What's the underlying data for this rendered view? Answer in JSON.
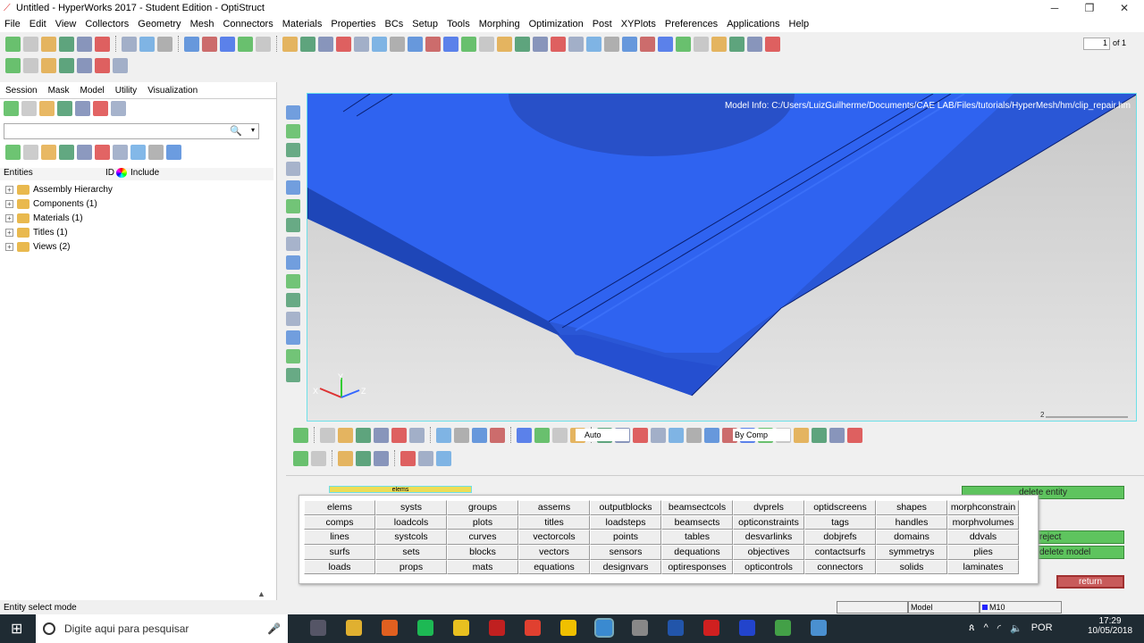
{
  "window": {
    "title": "Untitled - HyperWorks 2017 - Student Edition - OptiStruct"
  },
  "menu": [
    "File",
    "Edit",
    "View",
    "Collectors",
    "Geometry",
    "Mesh",
    "Connectors",
    "Materials",
    "Properties",
    "BCs",
    "Setup",
    "Tools",
    "Morphing",
    "Optimization",
    "Post",
    "XYPlots",
    "Preferences",
    "Applications",
    "Help"
  ],
  "page_nav": {
    "value": "1",
    "of": "of 1"
  },
  "browser": {
    "tabs": [
      "Session",
      "Mask",
      "Model",
      "Utility",
      "Visualization"
    ],
    "active_tab": "Model",
    "columns": [
      "Entities",
      "ID",
      "Include"
    ],
    "tree": [
      "Assembly Hierarchy",
      "Components (1)",
      "Materials (1)",
      "Titles (1)",
      "Views (2)"
    ]
  },
  "viewport": {
    "model_info": "Model Info: C:/Users/LuizGuilherme/Documents/CAE LAB/Files/tutorials/HyperMesh/hm/clip_repair.hm",
    "axes": {
      "x": "X",
      "y": "Y",
      "z": "Z"
    },
    "scale": "2"
  },
  "view_toolbar": {
    "color_mode": "Auto",
    "color_by": "By Comp"
  },
  "panel": {
    "entity_selector": "elems",
    "entities": [
      "elems",
      "systs",
      "groups",
      "assems",
      "outputblocks",
      "beamsectcols",
      "dvprels",
      "optidscreens",
      "shapes",
      "morphconstrain",
      "comps",
      "loadcols",
      "plots",
      "titles",
      "loadsteps",
      "beamsects",
      "opticonstraints",
      "tags",
      "handles",
      "morphvolumes",
      "lines",
      "systcols",
      "curves",
      "vectorcols",
      "points",
      "tables",
      "desvarlinks",
      "dobjrefs",
      "domains",
      "ddvals",
      "surfs",
      "sets",
      "blocks",
      "vectors",
      "sensors",
      "dequations",
      "objectives",
      "contactsurfs",
      "symmetrys",
      "plies",
      "loads",
      "props",
      "mats",
      "equations",
      "designvars",
      "optiresponses",
      "opticontrols",
      "connectors",
      "solids",
      "laminates"
    ],
    "buttons": {
      "delete_entity": "delete entity",
      "reject": "reject",
      "delete_model": "delete model",
      "return": "return"
    }
  },
  "status": {
    "message": "Entity select mode",
    "model": "Model",
    "component": "M10"
  },
  "taskbar": {
    "search_placeholder": "Digite aqui para pesquisar",
    "lang": "POR",
    "time": "17:29",
    "date": "10/05/2018"
  },
  "colors": {
    "model": "#2f63f0",
    "return": "#c85a5a",
    "green": "#5ec45e"
  }
}
